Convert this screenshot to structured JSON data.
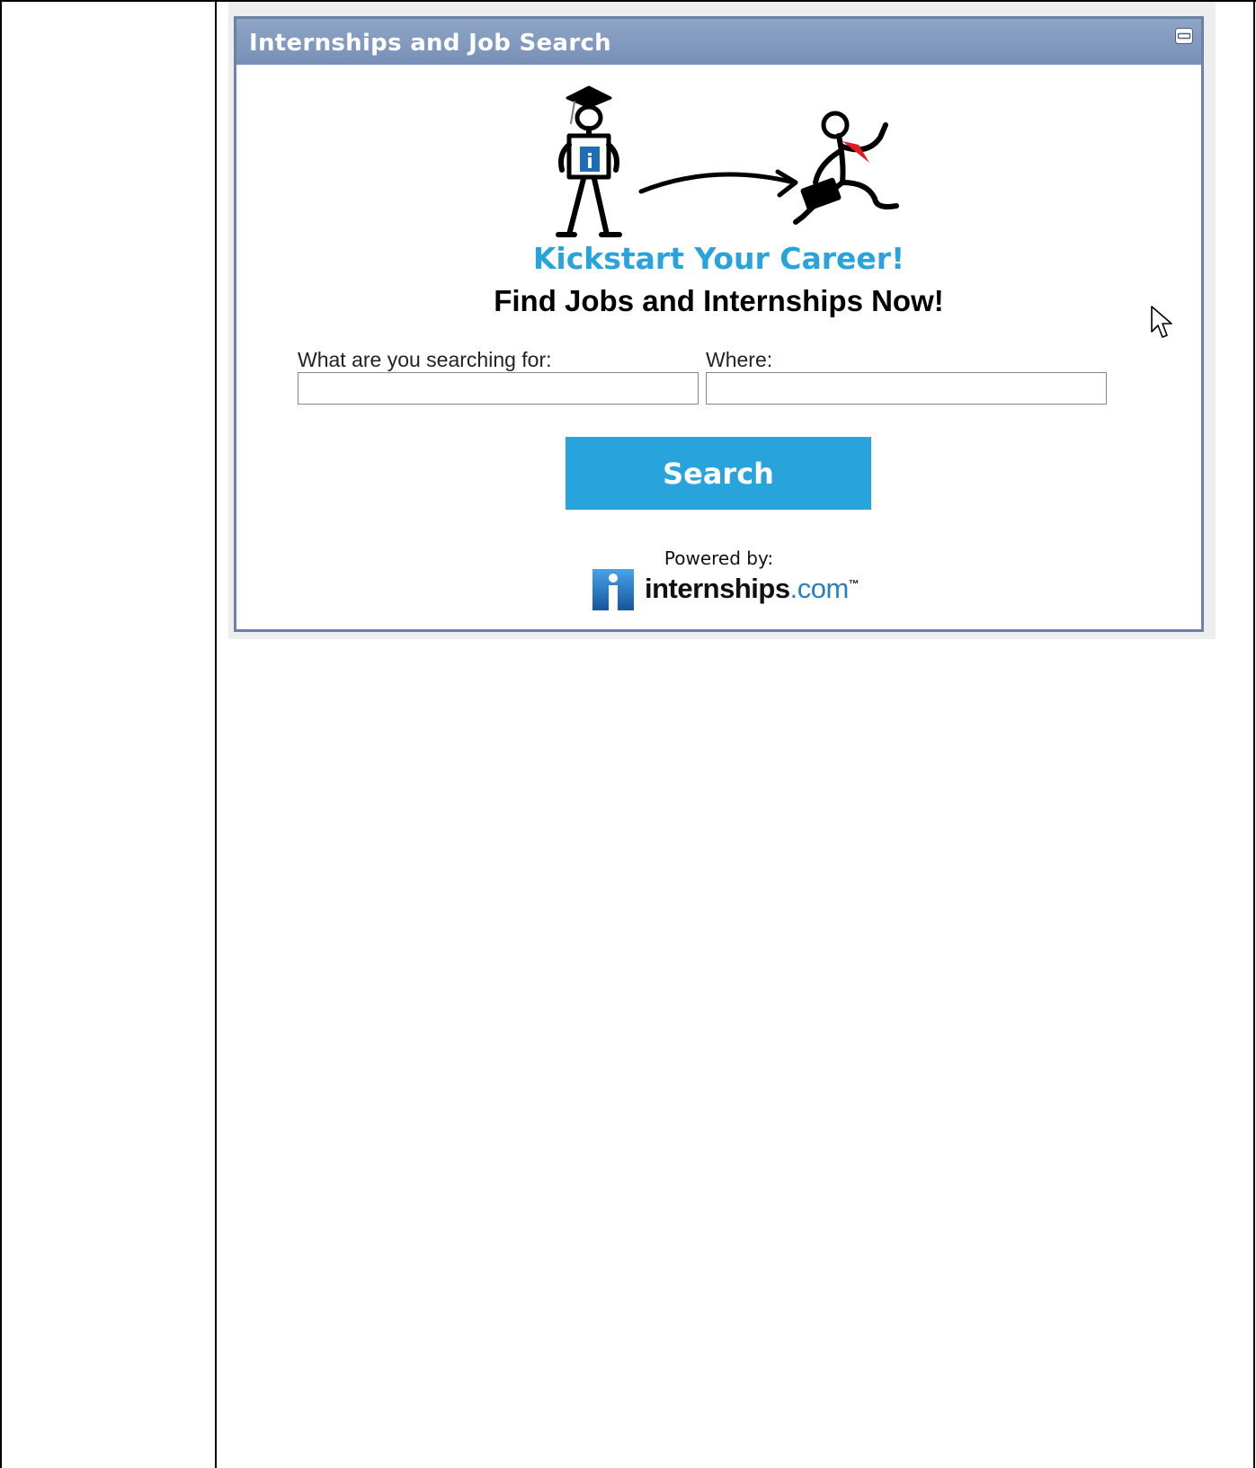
{
  "portlet": {
    "title": "Internships and Job Search",
    "minimize_icon": "minimize-icon"
  },
  "hero": {
    "headline": "Kickstart Your Career!",
    "subheadline": "Find Jobs and Internships Now!"
  },
  "form": {
    "what_label": "What are you searching for:",
    "what_value": "",
    "where_label": "Where:",
    "where_value": "",
    "search_button_label": "Search"
  },
  "footer": {
    "powered_by": "Powered by:",
    "logo_name": "internships",
    "logo_suffix": ".com",
    "logo_tm": "™"
  },
  "colors": {
    "header_bar": "#7890b6",
    "accent_blue": "#29a3dc",
    "tie_red": "#e11b22"
  }
}
